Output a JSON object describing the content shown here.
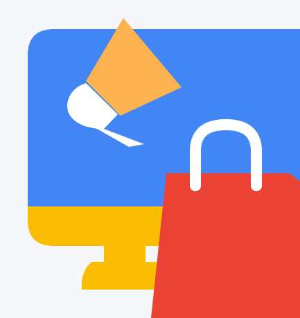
{
  "illustration": {
    "colors": {
      "background": "#f6f7fb",
      "screen": "#4285f4",
      "monitor_base": "#fbbc04",
      "megaphone_cone": "#fbb24f",
      "megaphone_handle": "#ffffff",
      "bag_body": "#ea4335",
      "bag_handle": "#ffffff"
    },
    "icons": [
      "monitor-icon",
      "megaphone-icon",
      "shopping-bag-icon"
    ]
  }
}
